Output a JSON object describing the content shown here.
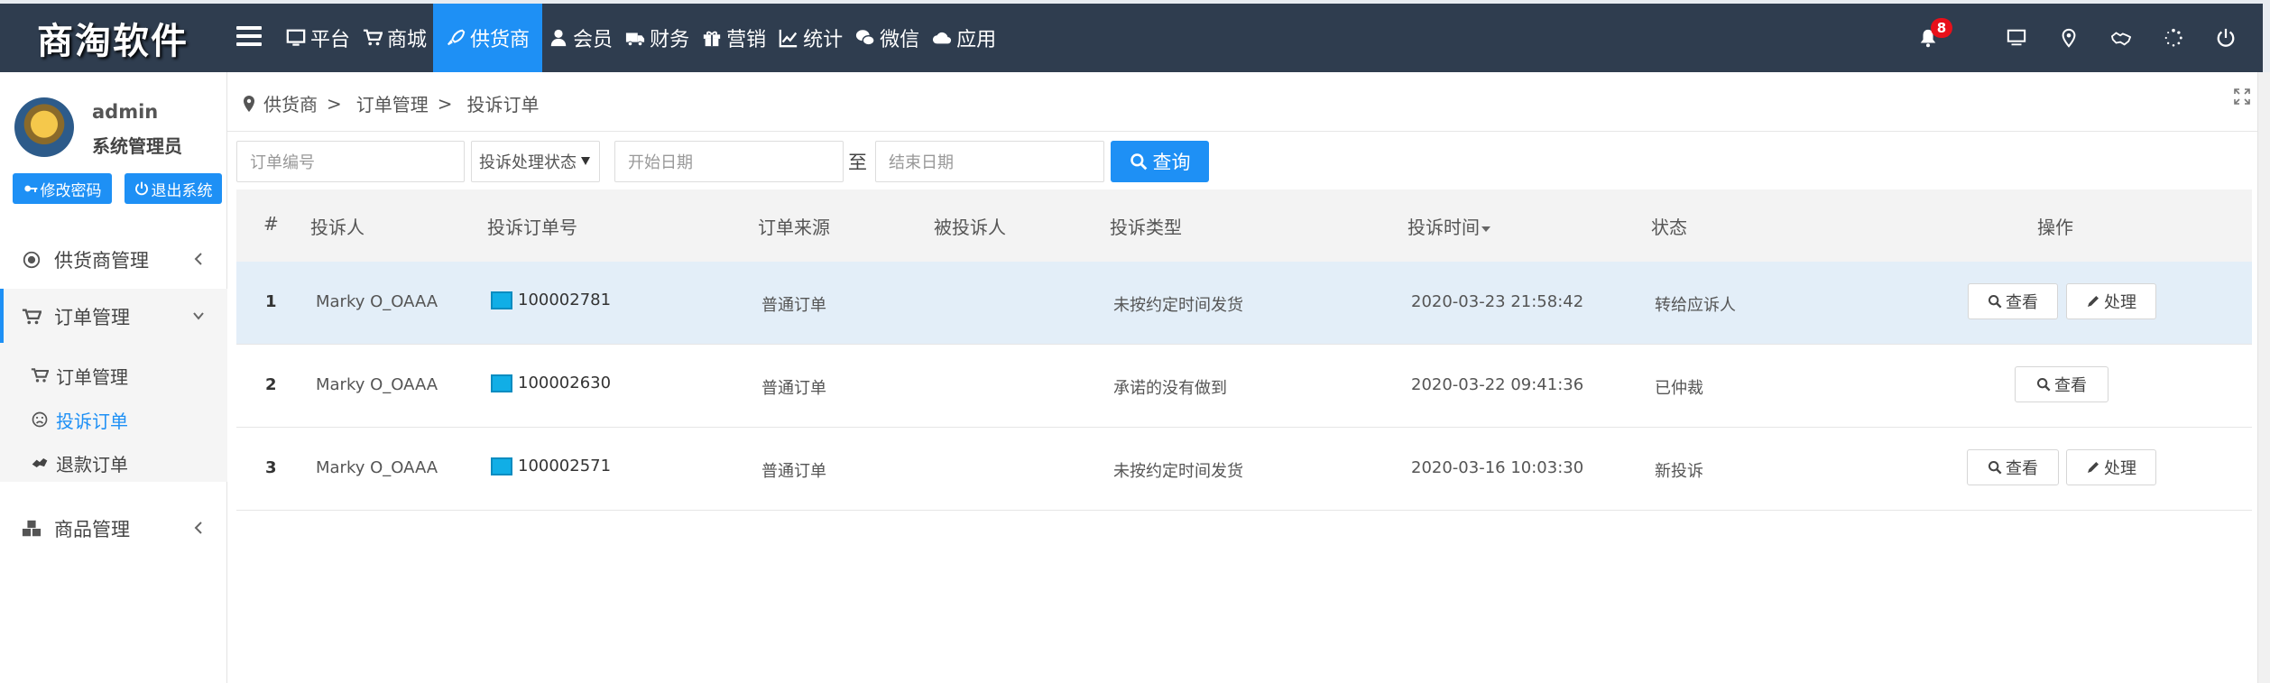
{
  "app": {
    "logo": "商淘软件",
    "notification_count": "8"
  },
  "topnav": [
    {
      "label": "平台",
      "icon": "monitor-icon"
    },
    {
      "label": "商城",
      "icon": "cart-icon"
    },
    {
      "label": "供货商",
      "icon": "rocket-icon",
      "active": true
    },
    {
      "label": "会员",
      "icon": "user-icon"
    },
    {
      "label": "财务",
      "icon": "truck-icon"
    },
    {
      "label": "营销",
      "icon": "gift-icon"
    },
    {
      "label": "统计",
      "icon": "chart-icon"
    },
    {
      "label": "微信",
      "icon": "wechat-icon"
    },
    {
      "label": "应用",
      "icon": "cloud-icon"
    }
  ],
  "user": {
    "name": "admin",
    "role": "系统管理员",
    "change_password": "修改密码",
    "logout": "退出系统"
  },
  "sidebar": {
    "groups": [
      {
        "label": "供货商管理"
      },
      {
        "label": "订单管理"
      },
      {
        "label": "商品管理"
      }
    ],
    "subitems": [
      {
        "label": "订单管理"
      },
      {
        "label": "投诉订单"
      },
      {
        "label": "退款订单"
      }
    ]
  },
  "breadcrumb": {
    "l1": "供货商",
    "l2": "订单管理",
    "l3": "投诉订单",
    "sep": ">"
  },
  "filters": {
    "order_no_placeholder": "订单编号",
    "status_select": "投诉处理状态",
    "start_placeholder": "开始日期",
    "to": "至",
    "end_placeholder": "结束日期",
    "query": "查询"
  },
  "table": {
    "headers": [
      "#",
      "投诉人",
      "投诉订单号",
      "订单来源",
      "被投诉人",
      "投诉类型",
      "投诉时间",
      "状态",
      "操作"
    ],
    "rows": [
      {
        "idx": "1",
        "complainant": "Marky O_OAAA",
        "order_no": "100002781",
        "source": "普通订单",
        "respondent": "",
        "type": "未按约定时间发货",
        "time": "2020-03-23 21:58:42",
        "status": "转给应诉人",
        "actions": [
          "查看",
          "处理"
        ]
      },
      {
        "idx": "2",
        "complainant": "Marky O_OAAA",
        "order_no": "100002630",
        "source": "普通订单",
        "respondent": "",
        "type": "承诺的没有做到",
        "time": "2020-03-22 09:41:36",
        "status": "已仲裁",
        "actions": [
          "查看"
        ]
      },
      {
        "idx": "3",
        "complainant": "Marky O_OAAA",
        "order_no": "100002571",
        "source": "普通订单",
        "respondent": "",
        "type": "未按约定时间发货",
        "time": "2020-03-16 10:03:30",
        "status": "新投诉",
        "actions": [
          "查看",
          "处理"
        ]
      }
    ]
  },
  "colors": {
    "topbar": "#2f3d4f",
    "accent": "#1e90f5",
    "badge": "#e8101a",
    "highlight_row": "#e3eef8"
  }
}
